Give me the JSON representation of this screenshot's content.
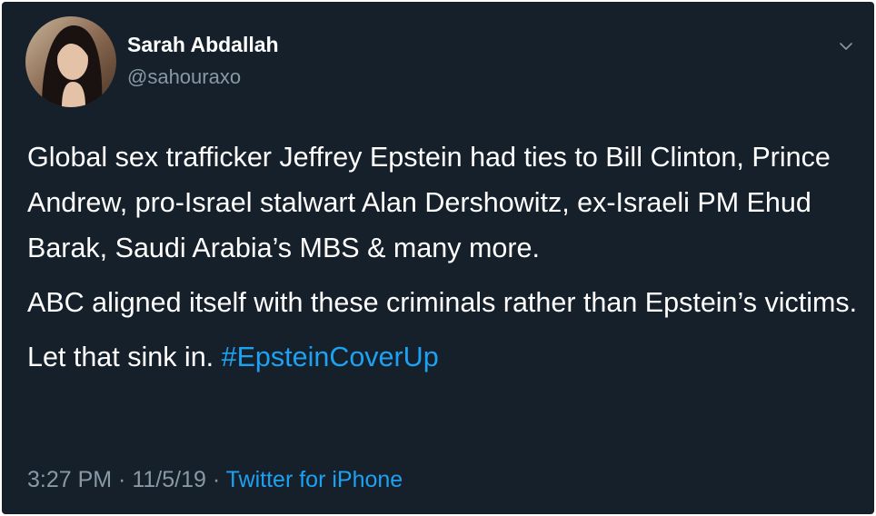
{
  "tweet": {
    "author": {
      "name": "Sarah Abdallah",
      "handle": "@sahouraxo"
    },
    "paragraphs": [
      "Global sex trafficker Jeffrey Epstein had ties to Bill Clinton, Prince Andrew, pro-Israel stalwart Alan Dershowitz, ex-Israeli PM Ehud Barak, Saudi Arabia’s MBS & many more.",
      "ABC aligned itself with these criminals rather than Epstein’s victims."
    ],
    "final_text": "Let that sink in. ",
    "hashtag": "#EpsteinCoverUp",
    "time": "3:27 PM",
    "date": "11/5/19",
    "separator": " · ",
    "source": "Twitter for iPhone"
  },
  "colors": {
    "background": "#15202b",
    "text": "#ffffff",
    "secondary": "#8899a6",
    "link": "#1da1f2"
  },
  "icons": {
    "menu": "chevron-down-icon",
    "avatar": "avatar"
  }
}
